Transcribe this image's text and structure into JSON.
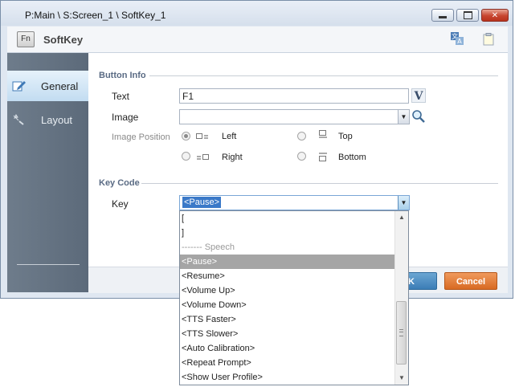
{
  "window": {
    "title": "P:Main \\ S:Screen_1 \\ SoftKey_1",
    "min_icon": "minimize-icon",
    "max_icon": "maximize-icon",
    "close_icon": "close-icon"
  },
  "header": {
    "app_icon_text": "Fn",
    "title": "SoftKey",
    "right_icons": [
      "translate-icon",
      "note-icon"
    ]
  },
  "sidebar": {
    "items": [
      {
        "label": "General",
        "icon": "edit-icon",
        "active": true
      },
      {
        "label": "Layout",
        "icon": "layout-tools-icon",
        "active": false
      }
    ]
  },
  "button_info": {
    "section_label": "Button Info",
    "text_label": "Text",
    "text_value": "F1",
    "v_button_label": "V",
    "image_label": "Image",
    "image_value": "",
    "image_position_label": "Image Position",
    "positions": [
      {
        "label": "Left",
        "checked": true,
        "icon": "image-left-icon"
      },
      {
        "label": "Top",
        "checked": false,
        "icon": "image-top-icon"
      },
      {
        "label": "Right",
        "checked": false,
        "icon": "image-right-icon"
      },
      {
        "label": "Bottom",
        "checked": false,
        "icon": "image-bottom-icon"
      }
    ]
  },
  "key_code": {
    "section_label": "Key Code",
    "key_label": "Key",
    "key_value": "<Pause>",
    "dropdown_items": [
      "[",
      "]",
      "------- Speech",
      "<Pause>",
      "<Resume>",
      "<Volume Up>",
      "<Volume Down>",
      "<TTS Faster>",
      "<TTS Slower>",
      "<Auto Calibration>",
      "<Repeat Prompt>",
      "<Show User Profile>"
    ],
    "highlighted_index": 3
  },
  "footer": {
    "ok_label": "K",
    "cancel_label": "Cancel"
  },
  "colors": {
    "selection": "#3a79c8",
    "ok_button": "#3b7db6",
    "cancel_button": "#d86a23",
    "sidebar": "#5c6a7a"
  }
}
